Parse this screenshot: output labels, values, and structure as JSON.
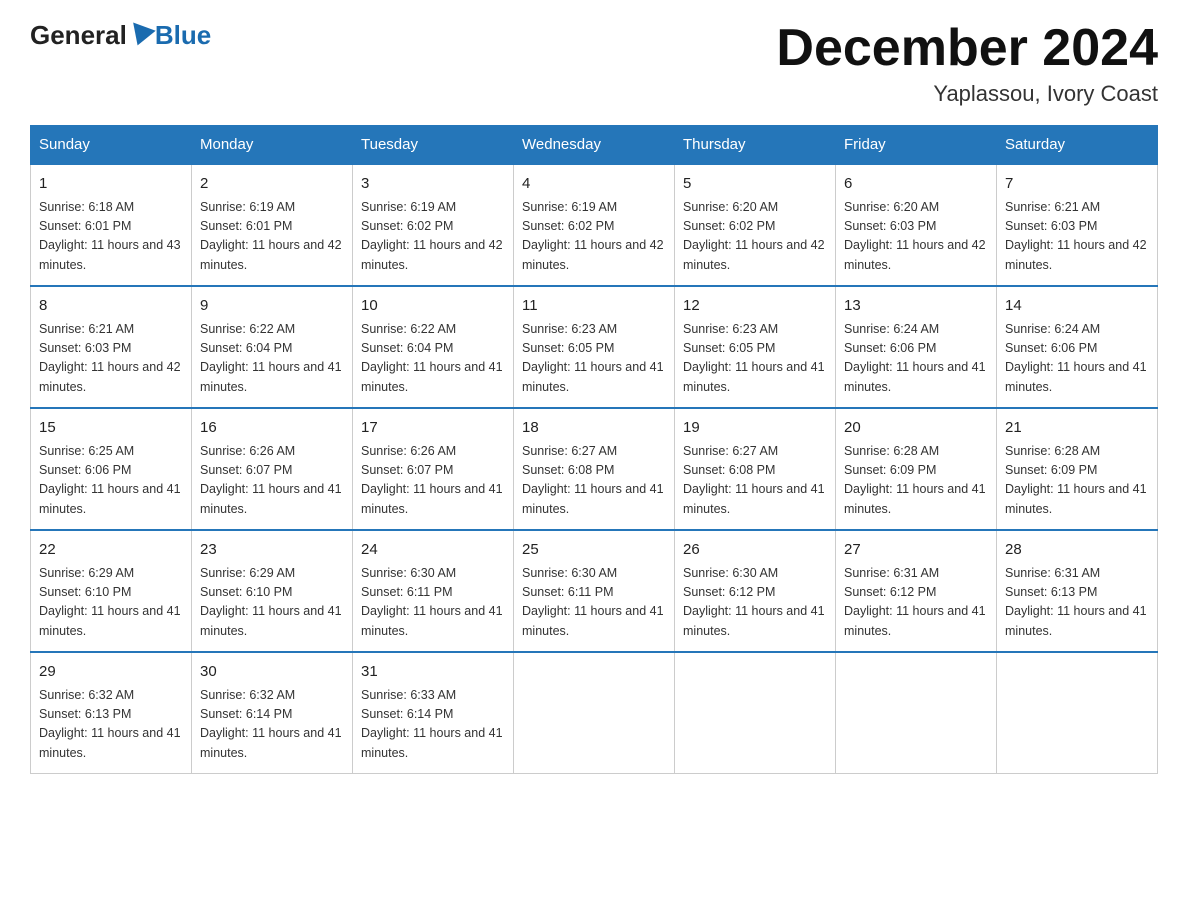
{
  "header": {
    "logo_general": "General",
    "logo_blue": "Blue",
    "month_title": "December 2024",
    "location": "Yaplassou, Ivory Coast"
  },
  "days_of_week": [
    "Sunday",
    "Monday",
    "Tuesday",
    "Wednesday",
    "Thursday",
    "Friday",
    "Saturday"
  ],
  "weeks": [
    [
      {
        "day": "1",
        "sunrise": "6:18 AM",
        "sunset": "6:01 PM",
        "daylight": "11 hours and 43 minutes."
      },
      {
        "day": "2",
        "sunrise": "6:19 AM",
        "sunset": "6:01 PM",
        "daylight": "11 hours and 42 minutes."
      },
      {
        "day": "3",
        "sunrise": "6:19 AM",
        "sunset": "6:02 PM",
        "daylight": "11 hours and 42 minutes."
      },
      {
        "day": "4",
        "sunrise": "6:19 AM",
        "sunset": "6:02 PM",
        "daylight": "11 hours and 42 minutes."
      },
      {
        "day": "5",
        "sunrise": "6:20 AM",
        "sunset": "6:02 PM",
        "daylight": "11 hours and 42 minutes."
      },
      {
        "day": "6",
        "sunrise": "6:20 AM",
        "sunset": "6:03 PM",
        "daylight": "11 hours and 42 minutes."
      },
      {
        "day": "7",
        "sunrise": "6:21 AM",
        "sunset": "6:03 PM",
        "daylight": "11 hours and 42 minutes."
      }
    ],
    [
      {
        "day": "8",
        "sunrise": "6:21 AM",
        "sunset": "6:03 PM",
        "daylight": "11 hours and 42 minutes."
      },
      {
        "day": "9",
        "sunrise": "6:22 AM",
        "sunset": "6:04 PM",
        "daylight": "11 hours and 41 minutes."
      },
      {
        "day": "10",
        "sunrise": "6:22 AM",
        "sunset": "6:04 PM",
        "daylight": "11 hours and 41 minutes."
      },
      {
        "day": "11",
        "sunrise": "6:23 AM",
        "sunset": "6:05 PM",
        "daylight": "11 hours and 41 minutes."
      },
      {
        "day": "12",
        "sunrise": "6:23 AM",
        "sunset": "6:05 PM",
        "daylight": "11 hours and 41 minutes."
      },
      {
        "day": "13",
        "sunrise": "6:24 AM",
        "sunset": "6:06 PM",
        "daylight": "11 hours and 41 minutes."
      },
      {
        "day": "14",
        "sunrise": "6:24 AM",
        "sunset": "6:06 PM",
        "daylight": "11 hours and 41 minutes."
      }
    ],
    [
      {
        "day": "15",
        "sunrise": "6:25 AM",
        "sunset": "6:06 PM",
        "daylight": "11 hours and 41 minutes."
      },
      {
        "day": "16",
        "sunrise": "6:26 AM",
        "sunset": "6:07 PM",
        "daylight": "11 hours and 41 minutes."
      },
      {
        "day": "17",
        "sunrise": "6:26 AM",
        "sunset": "6:07 PM",
        "daylight": "11 hours and 41 minutes."
      },
      {
        "day": "18",
        "sunrise": "6:27 AM",
        "sunset": "6:08 PM",
        "daylight": "11 hours and 41 minutes."
      },
      {
        "day": "19",
        "sunrise": "6:27 AM",
        "sunset": "6:08 PM",
        "daylight": "11 hours and 41 minutes."
      },
      {
        "day": "20",
        "sunrise": "6:28 AM",
        "sunset": "6:09 PM",
        "daylight": "11 hours and 41 minutes."
      },
      {
        "day": "21",
        "sunrise": "6:28 AM",
        "sunset": "6:09 PM",
        "daylight": "11 hours and 41 minutes."
      }
    ],
    [
      {
        "day": "22",
        "sunrise": "6:29 AM",
        "sunset": "6:10 PM",
        "daylight": "11 hours and 41 minutes."
      },
      {
        "day": "23",
        "sunrise": "6:29 AM",
        "sunset": "6:10 PM",
        "daylight": "11 hours and 41 minutes."
      },
      {
        "day": "24",
        "sunrise": "6:30 AM",
        "sunset": "6:11 PM",
        "daylight": "11 hours and 41 minutes."
      },
      {
        "day": "25",
        "sunrise": "6:30 AM",
        "sunset": "6:11 PM",
        "daylight": "11 hours and 41 minutes."
      },
      {
        "day": "26",
        "sunrise": "6:30 AM",
        "sunset": "6:12 PM",
        "daylight": "11 hours and 41 minutes."
      },
      {
        "day": "27",
        "sunrise": "6:31 AM",
        "sunset": "6:12 PM",
        "daylight": "11 hours and 41 minutes."
      },
      {
        "day": "28",
        "sunrise": "6:31 AM",
        "sunset": "6:13 PM",
        "daylight": "11 hours and 41 minutes."
      }
    ],
    [
      {
        "day": "29",
        "sunrise": "6:32 AM",
        "sunset": "6:13 PM",
        "daylight": "11 hours and 41 minutes."
      },
      {
        "day": "30",
        "sunrise": "6:32 AM",
        "sunset": "6:14 PM",
        "daylight": "11 hours and 41 minutes."
      },
      {
        "day": "31",
        "sunrise": "6:33 AM",
        "sunset": "6:14 PM",
        "daylight": "11 hours and 41 minutes."
      },
      null,
      null,
      null,
      null
    ]
  ]
}
